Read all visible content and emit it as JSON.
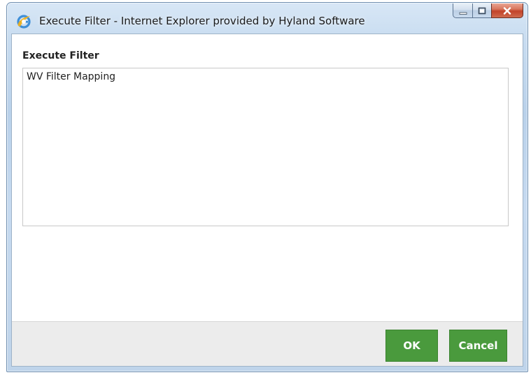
{
  "window": {
    "title": "Execute Filter - Internet Explorer provided by Hyland Software"
  },
  "dialog": {
    "heading": "Execute Filter",
    "filters": [
      {
        "label": "WV Filter Mapping"
      }
    ]
  },
  "buttons": {
    "ok_label": "OK",
    "cancel_label": "Cancel"
  },
  "colors": {
    "button_green": "#4a9a3d",
    "close_red": "#c2432a"
  },
  "icons": {
    "app_icon": "internet-explorer-icon",
    "minimize": "minimize-icon",
    "maximize": "maximize-icon",
    "close": "close-icon"
  }
}
